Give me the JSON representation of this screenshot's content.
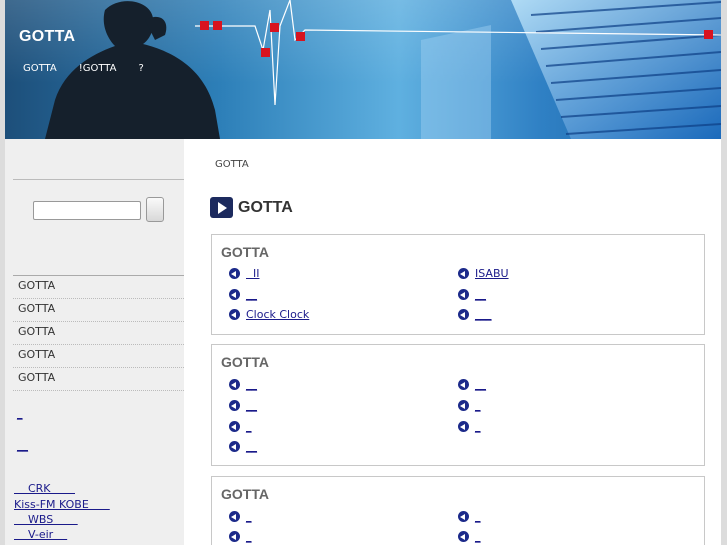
{
  "header": {
    "title": "GOTTA",
    "nav": [
      "GOTTA",
      "!GOTTA",
      "?"
    ]
  },
  "sidebar": {
    "search": {
      "value": "",
      "placeholder": ""
    },
    "menu": [
      "GOTTA",
      "GOTTA",
      "GOTTA",
      "GOTTA",
      "GOTTA"
    ],
    "small_links": [
      "_",
      "__"
    ],
    "radio_links": [
      "    CRK       ",
      "Kiss-FM KOBE      ",
      "    WBS       ",
      "    V-eir    "
    ]
  },
  "main": {
    "breadcrumb": "GOTTA",
    "heading": "GOTTA",
    "sections": [
      {
        "title": "GOTTA",
        "left": [
          "  II",
          "__",
          "Clock Clock"
        ],
        "right": [
          "ISABU",
          "__",
          "___"
        ]
      },
      {
        "title": "GOTTA",
        "left": [
          "__",
          "__",
          "_",
          "__"
        ],
        "right": [
          "__",
          "_",
          "_"
        ]
      },
      {
        "title": "GOTTA",
        "left": [
          "_",
          "_"
        ],
        "right": [
          "_",
          "_"
        ]
      }
    ]
  },
  "colors": {
    "accent": "#1c2a5e",
    "link": "#1a1a8a",
    "sidebar_bg": "#efefef",
    "header_blue": "#2d7fb8"
  }
}
